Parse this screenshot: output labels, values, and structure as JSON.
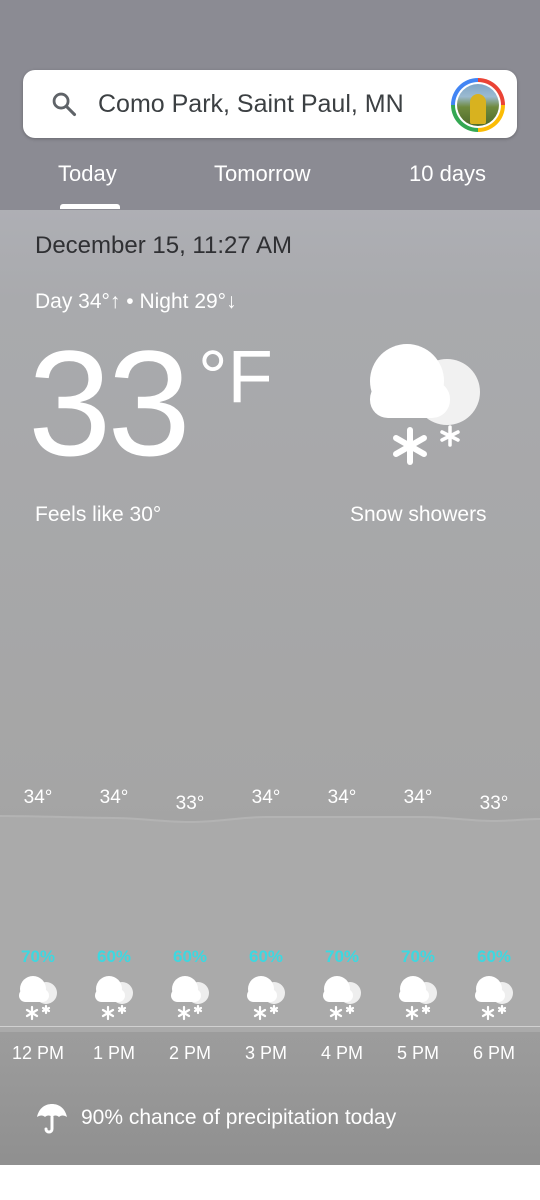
{
  "search": {
    "query": "Como Park, Saint Paul, MN",
    "icon": "search-icon"
  },
  "tabs": [
    {
      "label": "Today",
      "selected": true
    },
    {
      "label": "Tomorrow",
      "selected": false
    },
    {
      "label": "10 days",
      "selected": false
    }
  ],
  "current": {
    "datetime": "December 15, 11:27 AM",
    "day_night": "Day 34°↑ • Night 29°↓",
    "temp": "33",
    "unit": "°F",
    "feels_like": "Feels like 30°",
    "condition": "Snow showers",
    "condition_icon": "snow-showers-icon"
  },
  "hourly": [
    {
      "temp": "34°",
      "precip": "70%",
      "time": "12 PM"
    },
    {
      "temp": "34°",
      "precip": "60%",
      "time": "1 PM"
    },
    {
      "temp": "33°",
      "precip": "60%",
      "time": "2 PM"
    },
    {
      "temp": "34°",
      "precip": "60%",
      "time": "3 PM"
    },
    {
      "temp": "34°",
      "precip": "70%",
      "time": "4 PM"
    },
    {
      "temp": "34°",
      "precip": "70%",
      "time": "5 PM"
    },
    {
      "temp": "33°",
      "precip": "60%",
      "time": "6 PM"
    }
  ],
  "summary": {
    "text": "90% chance of precipitation today",
    "icon": "umbrella-icon"
  },
  "colors": {
    "precip_accent": "#3dd8e0",
    "top_bar": "#8b8b93"
  }
}
